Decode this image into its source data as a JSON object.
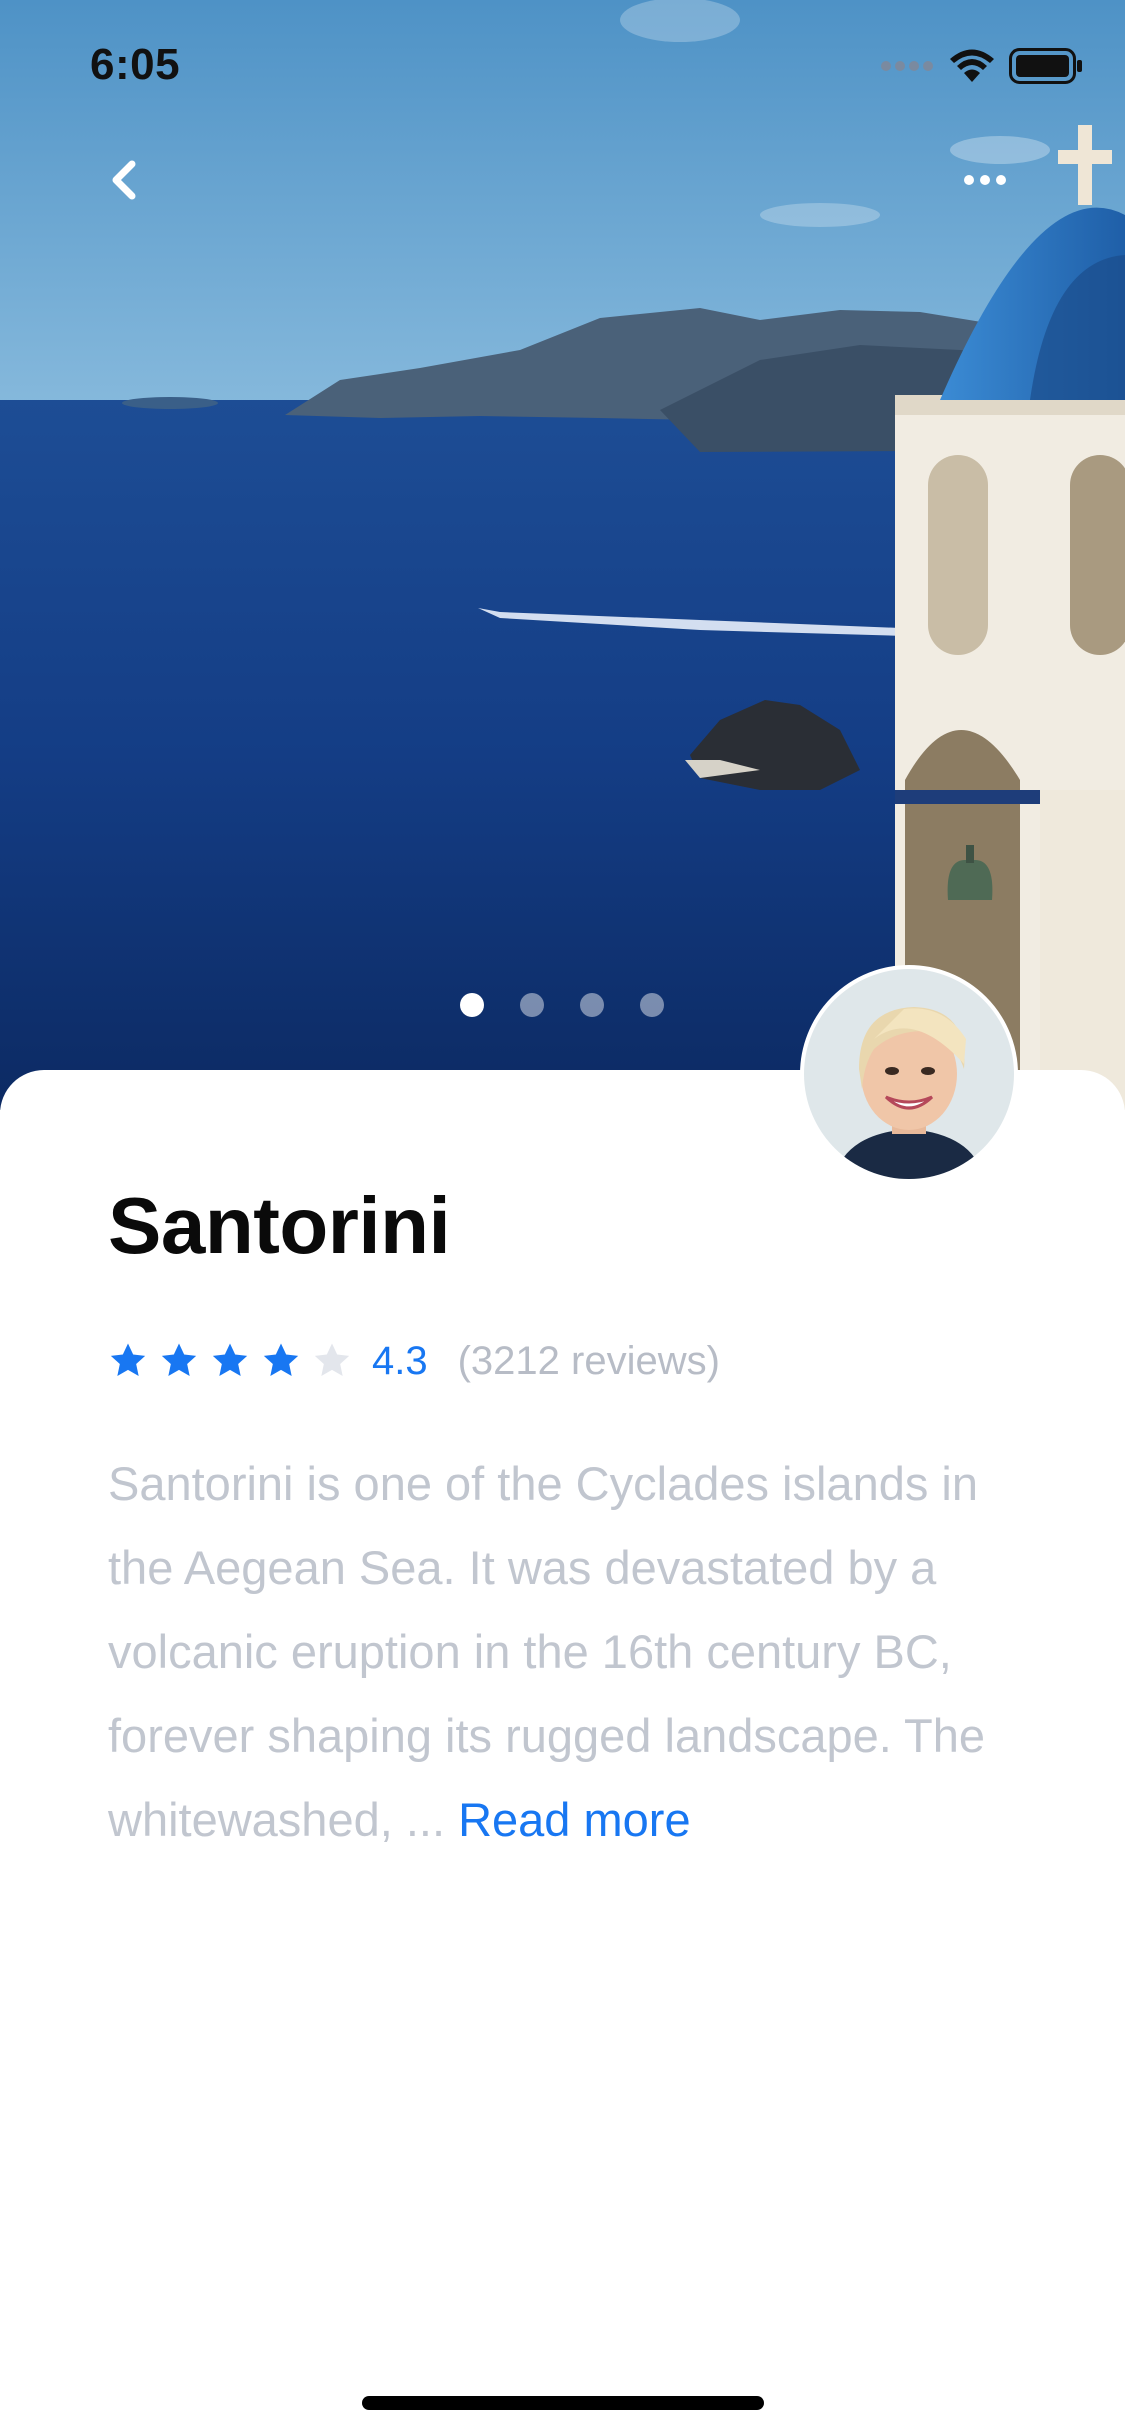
{
  "status_bar": {
    "time": "6:05"
  },
  "nav": {
    "back_icon": "chevron-left-icon",
    "more_icon": "ellipsis-icon"
  },
  "gallery": {
    "page_count": 4,
    "active_index": 0
  },
  "place": {
    "title": "Santorini",
    "rating": "4.3",
    "rating_value": 4.3,
    "stars_filled": 4,
    "stars_total": 5,
    "reviews": "(3212 reviews)",
    "description": "Santorini is one of the Cyclades islands in the Aegean Sea. It was devastated by a volcanic eruption in the 16th century BC, forever shaping its rugged landscape. The whitewashed, ...",
    "read_more": "Read more"
  },
  "colors": {
    "accent": "#1877f2",
    "muted_text": "#c1c6cf",
    "star_empty": "#e3e6ec",
    "title_text": "#0a0a0a"
  }
}
